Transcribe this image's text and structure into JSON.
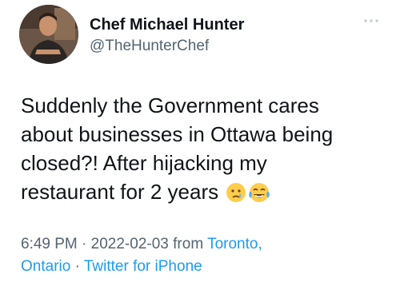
{
  "tweet": {
    "author_name": "Chef Michael Hunter",
    "author_handle": "@TheHunterChef",
    "more_icon": "more-horizontal-icon",
    "body_lines": [
      "Suddenly the Government cares",
      "about businesses in Ottawa being",
      "closed?! After hijacking my",
      "restaurant for 2 years"
    ],
    "emojis": [
      "crying-face-emoji",
      "face-with-tears-of-joy-emoji"
    ],
    "time": "6:49 PM",
    "separator": "·",
    "date": "2022-02-03",
    "from_text": "from",
    "location_part1": "Toronto,",
    "location_part2": "Ontario",
    "source": "Twitter for iPhone"
  },
  "colors": {
    "text": "#0f1419",
    "secondary": "#536471",
    "link": "#1d9bf0"
  }
}
